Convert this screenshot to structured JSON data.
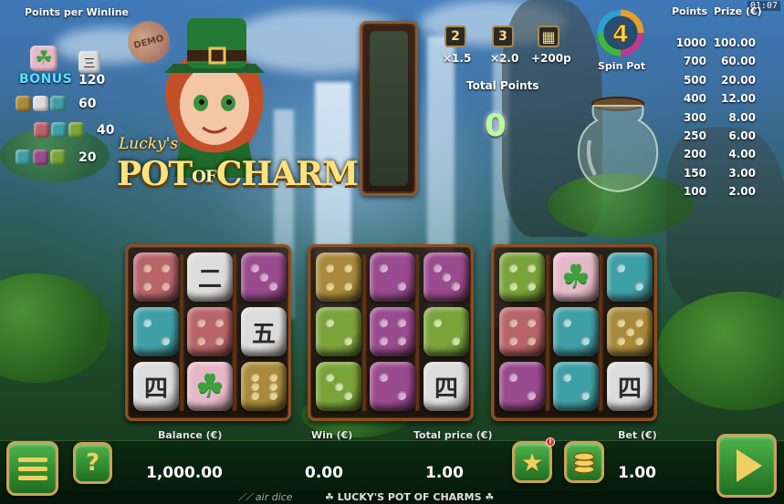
{
  "header": {
    "points_per_winline_label": "Points per Winline",
    "clock": "01:07",
    "demo_badge": "DEMO"
  },
  "paytable": {
    "bonus_label": "BONUS",
    "rows": [
      {
        "value": "120"
      },
      {
        "value": "60"
      },
      {
        "value": "40"
      },
      {
        "value": "20"
      }
    ]
  },
  "logo": {
    "small": "Lucky's",
    "pot": "POT",
    "of": "OF",
    "charms": "CHARMS"
  },
  "multipliers": [
    {
      "box": "2",
      "label": "×1.5"
    },
    {
      "box": "3",
      "label": "×2.0"
    },
    {
      "box": "grid",
      "label": "+200p"
    }
  ],
  "total_points": {
    "label": "Total Points",
    "value": "0"
  },
  "spin_pot": {
    "count": "4",
    "label": "Spin Pot"
  },
  "prize_table": {
    "points_header": "Points",
    "prize_header": "Prize (€)",
    "rows": [
      {
        "points": "1000",
        "prize": "100.00"
      },
      {
        "points": "700",
        "prize": "60.00"
      },
      {
        "points": "500",
        "prize": "20.00"
      },
      {
        "points": "400",
        "prize": "12.00"
      },
      {
        "points": "300",
        "prize": "8.00"
      },
      {
        "points": "250",
        "prize": "6.00"
      },
      {
        "points": "200",
        "prize": "4.00"
      },
      {
        "points": "150",
        "prize": "3.00"
      },
      {
        "points": "100",
        "prize": "2.00"
      }
    ]
  },
  "reels": [
    [
      {
        "color": "#b9646a",
        "type": "pips",
        "n": 4,
        "pipColor": "#e6b3a0"
      },
      {
        "color": "#dcdcdc",
        "type": "glyph",
        "glyph": "二"
      },
      {
        "color": "#9a4a8e",
        "type": "pips",
        "n": 3,
        "pipColor": "#d8a8d0"
      },
      {
        "color": "#3f9fa6",
        "type": "pips",
        "n": 2,
        "pipColor": "#a8dde0"
      },
      {
        "color": "#b9646a",
        "type": "pips",
        "n": 4,
        "pipColor": "#e6b3a0"
      },
      {
        "color": "#dcdcdc",
        "type": "glyph",
        "glyph": "五"
      },
      {
        "color": "#dcdcdc",
        "type": "glyph",
        "glyph": "四"
      },
      {
        "color": "#e5b8c8",
        "type": "clover",
        "glyph": "☘"
      },
      {
        "color": "#a98a3a",
        "type": "pips",
        "n": 6,
        "pipColor": "#e8d28a"
      }
    ],
    [
      {
        "color": "#a98a3a",
        "type": "pips",
        "n": 4,
        "pipColor": "#e8d28a"
      },
      {
        "color": "#9a4a8e",
        "type": "pips",
        "n": 2,
        "pipColor": "#d8a8d0"
      },
      {
        "color": "#9a4a8e",
        "type": "pips",
        "n": 3,
        "pipColor": "#d8a8d0"
      },
      {
        "color": "#7aa33a",
        "type": "pips",
        "n": 2,
        "pipColor": "#cfe39a"
      },
      {
        "color": "#9a4a8e",
        "type": "pips",
        "n": 4,
        "pipColor": "#d8a8d0"
      },
      {
        "color": "#7aa33a",
        "type": "pips",
        "n": 2,
        "pipColor": "#cfe39a"
      },
      {
        "color": "#7aa33a",
        "type": "pips",
        "n": 3,
        "pipColor": "#cfe39a"
      },
      {
        "color": "#9a4a8e",
        "type": "pips",
        "n": 2,
        "pipColor": "#d8a8d0"
      },
      {
        "color": "#dcdcdc",
        "type": "glyph",
        "glyph": "四"
      }
    ],
    [
      {
        "color": "#7aa33a",
        "type": "pips",
        "n": 4,
        "pipColor": "#cfe39a"
      },
      {
        "color": "#e5b8c8",
        "type": "clover",
        "glyph": "☘"
      },
      {
        "color": "#3f9fa6",
        "type": "pips",
        "n": 2,
        "pipColor": "#a8dde0"
      },
      {
        "color": "#b9646a",
        "type": "pips",
        "n": 4,
        "pipColor": "#e6b3a0"
      },
      {
        "color": "#3f9fa6",
        "type": "pips",
        "n": 2,
        "pipColor": "#a8dde0"
      },
      {
        "color": "#a98a3a",
        "type": "pips",
        "n": 5,
        "pipColor": "#e8d28a"
      },
      {
        "color": "#9a4a8e",
        "type": "pips",
        "n": 2,
        "pipColor": "#d8a8d0"
      },
      {
        "color": "#3f9fa6",
        "type": "pips",
        "n": 2,
        "pipColor": "#a8dde0"
      },
      {
        "color": "#dcdcdc",
        "type": "glyph",
        "glyph": "四"
      }
    ]
  ],
  "footer": {
    "balance_label": "Balance (€)",
    "balance_value": "1,000.00",
    "win_label": "Win (€)",
    "win_value": "0.00",
    "total_price_label": "Total price (€)",
    "total_price_value": "1.00",
    "bet_label": "Bet (€)",
    "bet_value": "1.00",
    "help_label": "?",
    "favorites_badge": "!",
    "brand": "air dice",
    "game_title": "LUCKY'S POT OF CHARMS"
  },
  "colors": {
    "accent_gold": "#c9a35a",
    "button_green": "#2f8f2f",
    "points_glow": "#b4ff9a"
  }
}
